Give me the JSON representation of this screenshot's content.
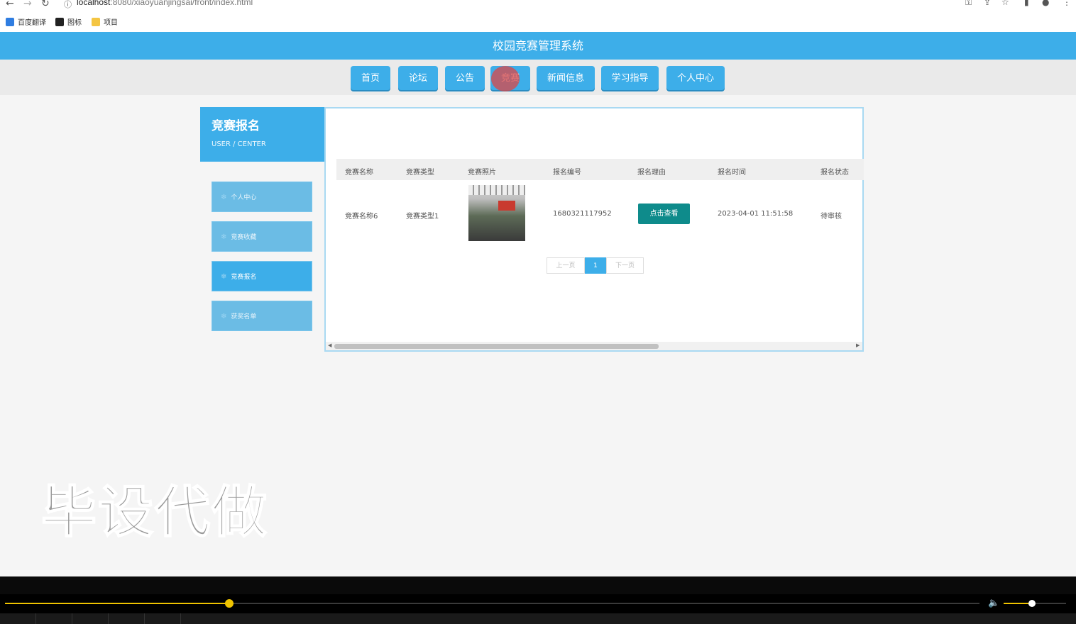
{
  "browser": {
    "url_host": "localhost",
    "url_path": ":8080/xiaoyuanjingsai/front/index.html",
    "bookmarks": [
      {
        "label": "百度翻译",
        "icon": "translate-icon",
        "color": "#2f7de1"
      },
      {
        "label": "图标",
        "icon": "image-icon",
        "color": "#222222"
      },
      {
        "label": "项目",
        "icon": "folder-icon",
        "color": "#f4c542"
      }
    ]
  },
  "header": {
    "title": "校园竞赛管理系统"
  },
  "menu": [
    {
      "label": "首页"
    },
    {
      "label": "论坛"
    },
    {
      "label": "公告"
    },
    {
      "label": "竞赛"
    },
    {
      "label": "新闻信息"
    },
    {
      "label": "学习指导"
    },
    {
      "label": "个人中心"
    }
  ],
  "sidebar": {
    "title": "竞赛报名",
    "subtitle": "USER / CENTER",
    "items": [
      {
        "label": "个人中心"
      },
      {
        "label": "竞赛收藏"
      },
      {
        "label": "竞赛报名"
      },
      {
        "label": "获奖名单"
      }
    ],
    "active_index": 2
  },
  "table": {
    "headers": [
      "竞赛名称",
      "竞赛类型",
      "竞赛照片",
      "报名编号",
      "报名理由",
      "报名时间",
      "报名状态"
    ],
    "rows": [
      {
        "name": "竞赛名称6",
        "type": "竞赛类型1",
        "number": "1680321117952",
        "reason_button": "点击查看",
        "time": "2023-04-01 11:51:58",
        "status": "待审核"
      }
    ]
  },
  "pager": {
    "prev": "上一页",
    "current": "1",
    "next": "下一页"
  },
  "watermark": "毕设代做",
  "player": {
    "progress": 0.23,
    "volume": 0.45
  },
  "colors": {
    "primary": "#3daee9",
    "teal_button": "#0e8b8b"
  }
}
